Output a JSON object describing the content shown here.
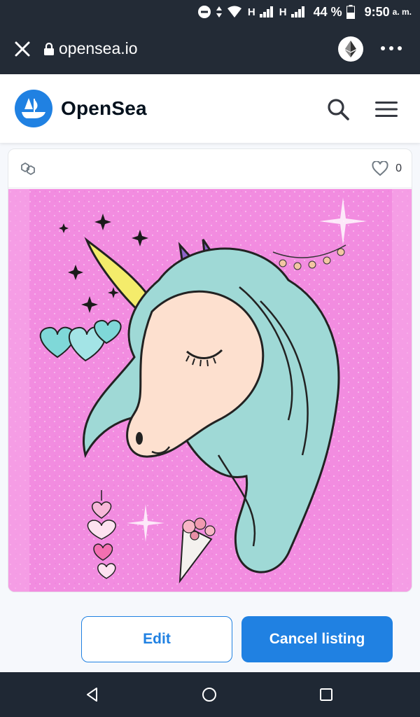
{
  "status_bar": {
    "network_1": "H",
    "network_2": "H",
    "battery": "44 %",
    "time": "9:50",
    "ampm": "a. m."
  },
  "browser": {
    "url": "opensea.io",
    "icons": [
      "close-icon",
      "lock-icon",
      "ethereum-icon",
      "more-options-icon"
    ]
  },
  "header": {
    "brand": "OpenSea",
    "icons": [
      "opensea-logo-icon",
      "search-icon",
      "hamburger-menu-icon"
    ]
  },
  "card": {
    "favorites_count": "0",
    "icons": [
      "polygon-chain-icon",
      "heart-icon"
    ],
    "image": "unicorn-artwork"
  },
  "actions": {
    "edit_label": "Edit",
    "cancel_label": "Cancel listing"
  },
  "nav": {
    "icons": [
      "back-icon",
      "home-icon",
      "recents-icon"
    ]
  },
  "colors": {
    "dark_bar": "#232b36",
    "accent": "#2081e2",
    "brand_text": "#04111d",
    "artwork_bg": "#f48fe0"
  }
}
